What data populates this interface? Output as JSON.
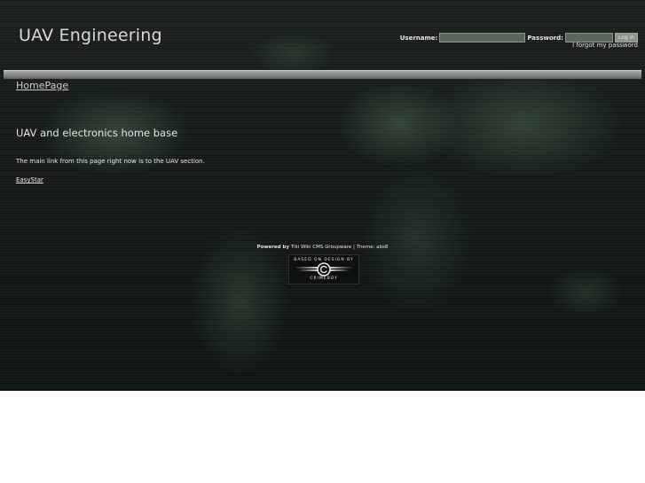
{
  "header": {
    "site_title": "UAV Engineering"
  },
  "login": {
    "username_label": "Username:",
    "password_label": "Password:",
    "username_value": "",
    "password_value": "",
    "login_button": "Log in",
    "forgot_link": "I forgot my password"
  },
  "breadcrumb": {
    "page": "HomePage"
  },
  "content": {
    "heading": "UAV and electronics home base",
    "paragraph": "The main link from this page right now is to the UAV section.",
    "link": "EasyStar"
  },
  "footer": {
    "powered_by": "Powered by",
    "powered_rest": "Tiki Wiki CMS Groupware | Theme: abs8",
    "badge_top": "BASED ON DESIGN BY",
    "badge_bottom": "CRIMEBOY"
  }
}
